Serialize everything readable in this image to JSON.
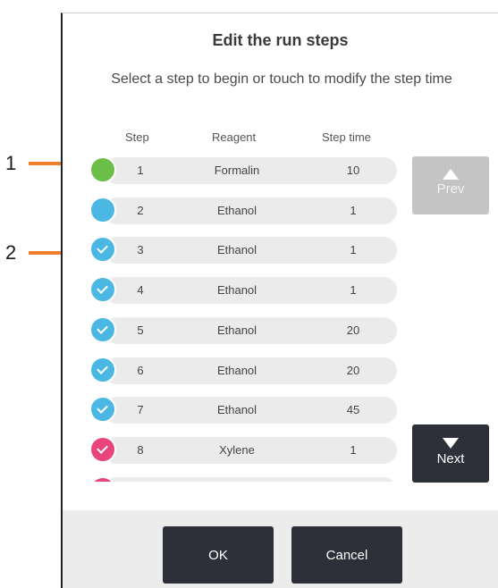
{
  "callouts": [
    "1",
    "2"
  ],
  "dialog": {
    "title": "Edit the run steps",
    "subtitle": "Select a step to begin or touch to modify the step time"
  },
  "columns": {
    "step": "Step",
    "reagent": "Reagent",
    "time": "Step time"
  },
  "steps": [
    {
      "step": "1",
      "reagent": "Formalin",
      "time": "10",
      "color": "#6cc04a",
      "checked": false
    },
    {
      "step": "2",
      "reagent": "Ethanol",
      "time": "1",
      "color": "#4bb8e3",
      "checked": false
    },
    {
      "step": "3",
      "reagent": "Ethanol",
      "time": "1",
      "color": "#4bb8e3",
      "checked": true
    },
    {
      "step": "4",
      "reagent": "Ethanol",
      "time": "1",
      "color": "#4bb8e3",
      "checked": true
    },
    {
      "step": "5",
      "reagent": "Ethanol",
      "time": "20",
      "color": "#4bb8e3",
      "checked": true
    },
    {
      "step": "6",
      "reagent": "Ethanol",
      "time": "20",
      "color": "#4bb8e3",
      "checked": true
    },
    {
      "step": "7",
      "reagent": "Ethanol",
      "time": "45",
      "color": "#4bb8e3",
      "checked": true
    },
    {
      "step": "8",
      "reagent": "Xylene",
      "time": "1",
      "color": "#e8457c",
      "checked": true
    },
    {
      "step": "",
      "reagent": "",
      "time": "",
      "color": "#e8457c",
      "checked": false
    }
  ],
  "nav": {
    "prev": "Prev",
    "next": "Next"
  },
  "footer": {
    "ok": "OK",
    "cancel": "Cancel"
  },
  "colors": {
    "arrow": "#f07f2c",
    "button_dark": "#2d3039",
    "button_disabled": "#c4c4c4"
  }
}
